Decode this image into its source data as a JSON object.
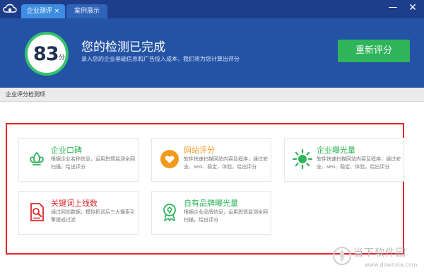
{
  "window": {
    "logo_icon": "cloud-shield-icon",
    "tabs": [
      {
        "label": "企业测评 ×",
        "active": true
      },
      {
        "label": "案例展示",
        "active": false
      }
    ],
    "minimize_label": "—",
    "close_label": "✕"
  },
  "header": {
    "score": "83",
    "score_unit": "分",
    "title": "您的检测已完成",
    "subtitle": "录入您的企业基础信息和广告投入成本，我们将为您计算出评分",
    "rescore_label": "重新评分"
  },
  "section": {
    "title": "企业评分检测项"
  },
  "cards": [
    {
      "title": "企业口碑",
      "desc": "根据企业名称信息，运用舆情监测全网扫描，给出评分",
      "icon": "lotus-icon",
      "color": "#2eb45a"
    },
    {
      "title": "网站评分",
      "desc": "软件快速扫描网站内容及程序，通过安全、seo、稳定、体验，给出评分",
      "icon": "heart-icon",
      "color": "#f39a1e"
    },
    {
      "title": "企业曝光量",
      "desc": "软件快速扫描网站内容及程序，通过安全、seo、稳定、体验，给出评分",
      "icon": "sun-icon",
      "color": "#2eb45a"
    },
    {
      "title": "关键词上线数",
      "desc": "通过网站数据，模拟拓词后三大搜索引擎提成过滤",
      "icon": "document-search-icon",
      "color": "#e0262b"
    },
    {
      "title": "自有品牌曝光量",
      "desc": "根据企业品牌信息，运用舆情监测全网扫描，给出评分",
      "icon": "medal-icon",
      "color": "#2eb45a"
    }
  ],
  "watermark": {
    "text": "当下软件园",
    "url": "www.downxia.com"
  },
  "colors": {
    "titlebar": "#1e3e8c",
    "header": "#2453a6",
    "active_tab": "#3d8de0",
    "score_ring": "#35c36d",
    "rescore_button": "#2eb45a",
    "highlight_box": "#e0262b"
  }
}
